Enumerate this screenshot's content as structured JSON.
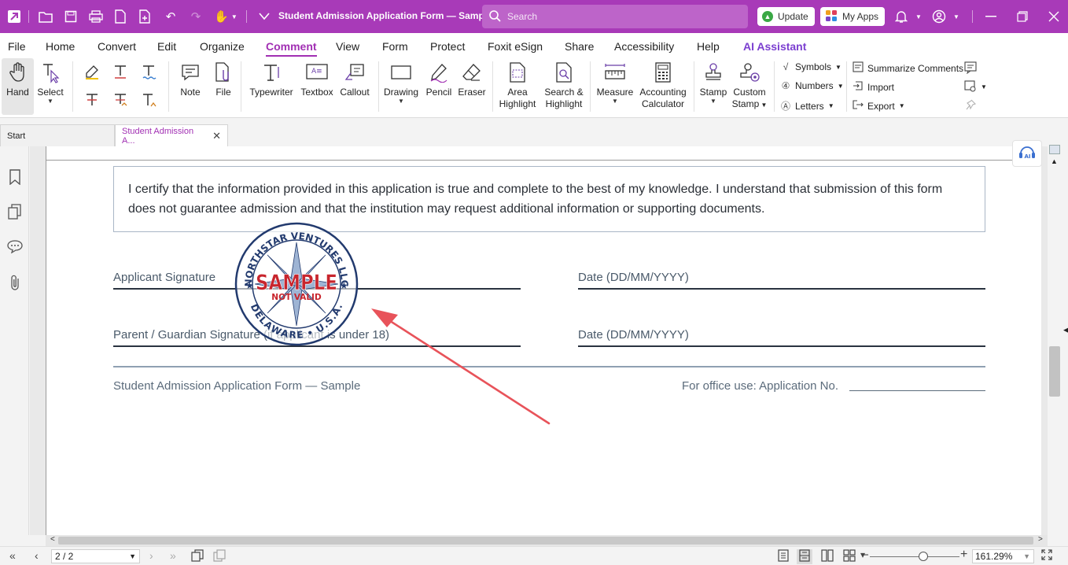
{
  "titlebar": {
    "doc_title": "Student Admission Application Form — Sample *",
    "search_placeholder": "Search",
    "update_label": "Update",
    "myapps_label": "My Apps",
    "colors": {
      "bar": "#a83ab8",
      "search": "#bd64c9"
    }
  },
  "menu": {
    "items": [
      "File",
      "Home",
      "Convert",
      "Edit",
      "Organize",
      "Comment",
      "View",
      "Form",
      "Protect",
      "Foxit eSign",
      "Share",
      "Accessibility",
      "Help",
      "AI Assistant"
    ],
    "active": "Comment"
  },
  "ribbon": {
    "hand": "Hand",
    "select": "Select",
    "note": "Note",
    "file": "File",
    "typewriter": "Typewriter",
    "textbox": "Textbox",
    "callout": "Callout",
    "drawing": "Drawing",
    "pencil": "Pencil",
    "eraser": "Eraser",
    "area_highlight_1": "Area",
    "area_highlight_2": "Highlight",
    "search_highlight_1": "Search &",
    "search_highlight_2": "Highlight",
    "measure": "Measure",
    "accounting_1": "Accounting",
    "accounting_2": "Calculator",
    "stamp": "Stamp",
    "custom_stamp_1": "Custom",
    "custom_stamp_2": "Stamp",
    "symbols": "Symbols",
    "numbers": "Numbers",
    "letters": "Letters",
    "summarize": "Summarize Comments",
    "import": "Import",
    "export": "Export"
  },
  "tabs": {
    "start": "Start",
    "doc": "Student Admission A..."
  },
  "document": {
    "certification": "I certify that the information provided in this application is true and complete to the best of my knowledge. I understand that submission of this form does not guarantee admission and that the institution may request additional information or supporting documents.",
    "applicant_sig": "Applicant Signature",
    "date_1": "Date (DD/MM/YYYY)",
    "guardian_sig": "Parent / Guardian Signature (if applicant is under 18)",
    "date_2": "Date (DD/MM/YYYY)",
    "footer_left": "Student Admission Application Form — Sample",
    "footer_right": "For office use: Application No.",
    "stamp": {
      "top_arc": "NORTHSTAR VENTURES LLC",
      "bottom_arc": "DELAWARE • U.S.A.",
      "main": "SAMPLE",
      "sub": "NOT VALID",
      "colors": {
        "ring": "#223a6e",
        "text": "#c8252d"
      }
    }
  },
  "status": {
    "page": "2 / 2",
    "zoom": "161.29%"
  }
}
